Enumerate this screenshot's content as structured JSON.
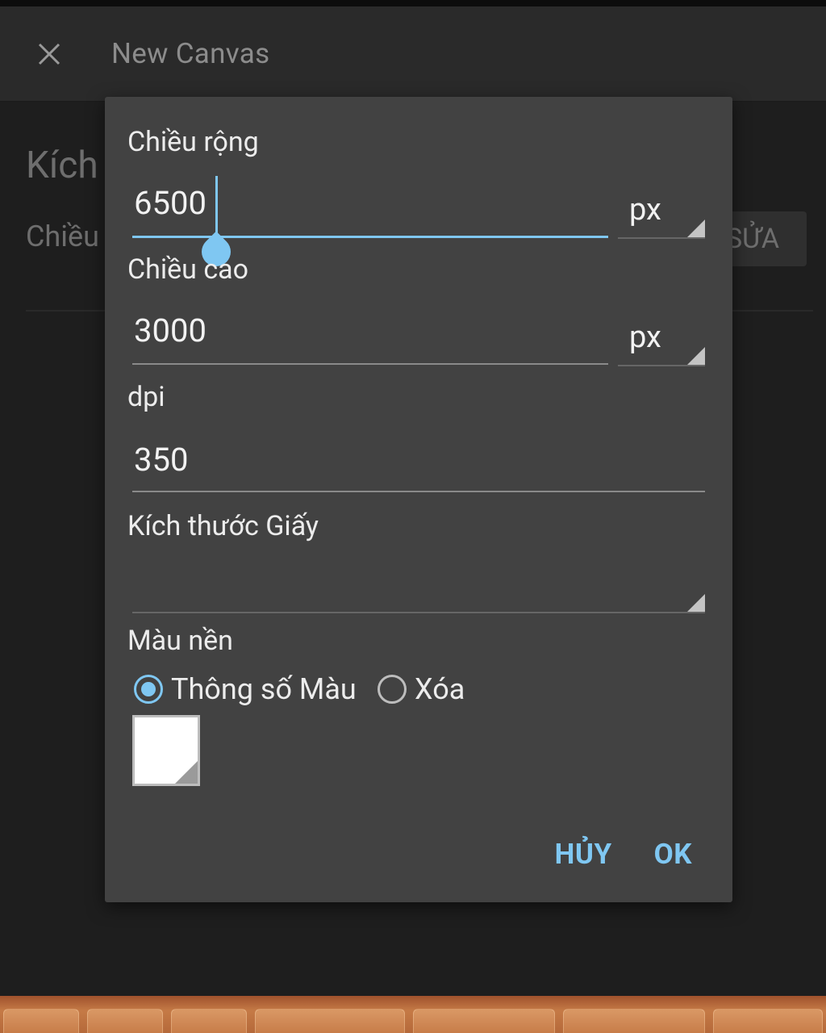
{
  "appbar": {
    "close_icon": "close-icon",
    "title": "New Canvas"
  },
  "background": {
    "heading": "Kích",
    "subline": "Chiều",
    "edit_button": "SỬA"
  },
  "dialog": {
    "width": {
      "label": "Chiều rộng",
      "value": "6500",
      "unit": "px"
    },
    "height": {
      "label": "Chiều cao",
      "value": "3000",
      "unit": "px"
    },
    "dpi": {
      "label": "dpi",
      "value": "350"
    },
    "paper_size": {
      "label": "Kích thước Giấy",
      "value": ""
    },
    "background_color": {
      "label": "Màu nền",
      "options": [
        "Thông số Màu",
        "Xóa"
      ],
      "selected": "Thông số Màu",
      "swatch_color": "#ffffff"
    },
    "buttons": {
      "cancel": "HỦY",
      "ok": "OK"
    }
  },
  "colors": {
    "accent": "#7fc7f2",
    "dialog_bg": "#424242",
    "page_bg": "#1e1e1e"
  }
}
